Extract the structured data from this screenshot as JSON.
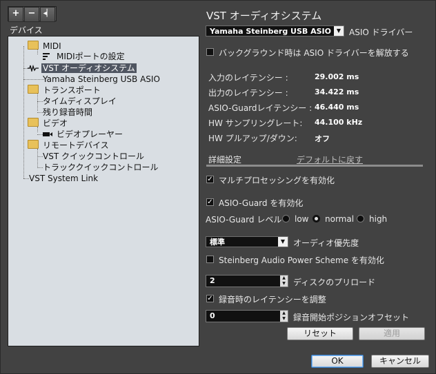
{
  "toolbar": {
    "add": "+",
    "remove": "−",
    "reset": "◂▏"
  },
  "tree": {
    "header": "デバイス",
    "items": [
      {
        "label": "MIDI"
      },
      {
        "label": "MIDIポートの設定"
      },
      {
        "label": "VST オーディオシステム"
      },
      {
        "label": "Yamaha Steinberg USB ASIO"
      },
      {
        "label": "トランスポート"
      },
      {
        "label": "タイムディスプレイ"
      },
      {
        "label": "残り録音時間"
      },
      {
        "label": "ビデオ"
      },
      {
        "label": "ビデオプレーヤー"
      },
      {
        "label": "リモートデバイス"
      },
      {
        "label": "VST クイックコントロール"
      },
      {
        "label": "トラッククイックコントロール"
      },
      {
        "label": "VST System Link"
      }
    ]
  },
  "panel": {
    "title": "VST オーディオシステム",
    "driver_value": "Yamaha Steinberg USB ASIO",
    "driver_label": "ASIO ドライバー",
    "release_label": "バックグラウンド時は ASIO ドライバーを解放する",
    "input_latency_label": "入力のレイテンシー :",
    "input_latency": "29.002 ms",
    "output_latency_label": "出力のレイテンシー :",
    "output_latency": "34.422 ms",
    "guard_latency_label": "ASIO-Guardレイテンシー :",
    "guard_latency": "46.440 ms",
    "sample_rate_label": "HW サンプリングレート:",
    "sample_rate": "44.100 kHz",
    "pullup_label": "HW プルアップ/ダウン:",
    "pullup": "オフ",
    "advanced_label": "詳細設定",
    "default_link": "デフォルトに戻す",
    "multiproc_label": "マルチプロセッシングを有効化",
    "guard_enable_label": "ASIO-Guard を有効化",
    "guard_level_label": "ASIO-Guard レベル :",
    "level_low": "low",
    "level_normal": "normal",
    "level_high": "high",
    "priority_value": "標準",
    "priority_label": "オーディオ優先度",
    "power_label": "Steinberg Audio Power Scheme を有効化",
    "preload_value": "2",
    "preload_label": "ディスクのプリロード",
    "adjust_label": "録音時のレイテンシーを調整",
    "offset_value": "0",
    "offset_label": "録音開始ポジションオフセット",
    "reset_button": "リセット",
    "apply_button": "適用"
  },
  "footer": {
    "ok": "OK",
    "cancel": "キャンセル"
  }
}
